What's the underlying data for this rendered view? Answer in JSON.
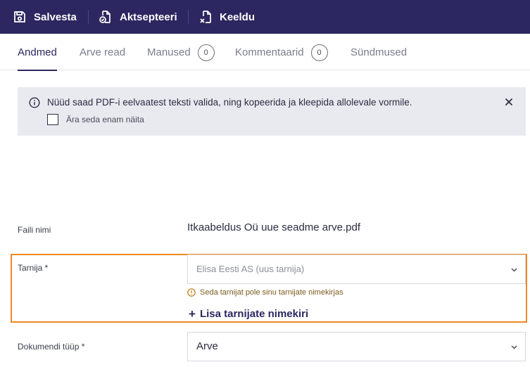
{
  "toolbar": {
    "save_label": "Salvesta",
    "accept_label": "Aktsepteeri",
    "reject_label": "Keeldu",
    "background_color": "#2c2760"
  },
  "tabs": [
    {
      "label": "Andmed",
      "active": true
    },
    {
      "label": "Arve read"
    },
    {
      "label": "Manused",
      "count": "0"
    },
    {
      "label": "Kommentaarid",
      "count": "0"
    },
    {
      "label": "Sündmused"
    }
  ],
  "banner": {
    "message": "Nüüd saad PDF-i eelvaatest teksti valida, ning kopeerida ja kleepida allolevale vormile.",
    "dont_show_label": "Ära seda enam näita",
    "dont_show_checked": false
  },
  "form": {
    "file_name_label": "Faili nimi",
    "file_name_value": "Itkaabeldus Oü uue seadme arve.pdf",
    "supplier_label": "Tarnija *",
    "supplier_value": "Elisa Eesti AS (uus tarnija)",
    "supplier_warning": "Seda tarnijat pole sinu tarnijate nimekirjas",
    "add_supplier_label": "Lisa tarnijate nimekiri",
    "doc_type_label": "Dokumendi tüüp *",
    "doc_type_value": "Arve"
  },
  "colors": {
    "highlight": "#f08a24",
    "banner_bg": "#e9eaf0",
    "accent": "#2c2760"
  }
}
